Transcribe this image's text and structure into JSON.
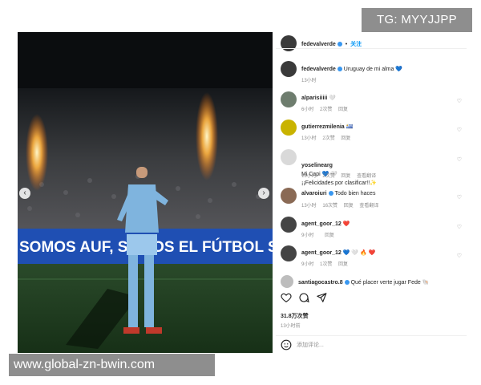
{
  "watermarks": {
    "top": "TG: MYYJJPP",
    "bottom": "www.global-zn-bwin.com"
  },
  "photo": {
    "banner_text": "SOMOS AUF, SOMOS EL FÚTBOL   SOMOS AUF, SOMOS EL FÚTBOL"
  },
  "header": {
    "username": "fedevalverde",
    "dot": "•",
    "follow": "关注"
  },
  "caption": {
    "username": "fedevalverde",
    "text": "Uruguay de mi alma 💙",
    "time": "13小时"
  },
  "comments": [
    {
      "username": "alparisiiiii",
      "text": "🤍",
      "time": "6小时",
      "likes": "2次赞",
      "reply": "回复",
      "translate": ""
    },
    {
      "username": "gutierrezmilenia",
      "text": "🇺🇾",
      "time": "13小时",
      "likes": "2次赞",
      "reply": "回复",
      "translate": ""
    },
    {
      "username": "yoselinearg",
      "text": "Mi Capi 💙 🤍\n¡¡Felicidades por clasificar!!✨",
      "time": "13小时",
      "likes": "2次赞",
      "reply": "回复",
      "translate": "查看翻译"
    },
    {
      "username": "alvaroiuri",
      "text": "Todo bien haces",
      "time": "13小时",
      "likes": "16次赞",
      "reply": "回复",
      "translate": "查看翻译"
    },
    {
      "username": "agent_goor_12",
      "text": "❤️",
      "time": "9小时",
      "likes": "",
      "reply": "回复",
      "translate": ""
    },
    {
      "username": "agent_goor_12",
      "text": "💙 🤍 🔥 ❤️",
      "time": "9小时",
      "likes": "1次赞",
      "reply": "回复",
      "translate": ""
    },
    {
      "username": "santiagocastro.8",
      "text": "Qué placer verte jugar Fede 🐚",
      "time": "",
      "likes": "",
      "reply": "",
      "translate": ""
    }
  ],
  "actions": {
    "likes": "31.8万次赞",
    "time": "13小时前",
    "comment_placeholder": "添加评论..."
  },
  "colors": {
    "accent": "#0095f6",
    "verified": "#3897f0",
    "banner": "#1f4fb3"
  }
}
